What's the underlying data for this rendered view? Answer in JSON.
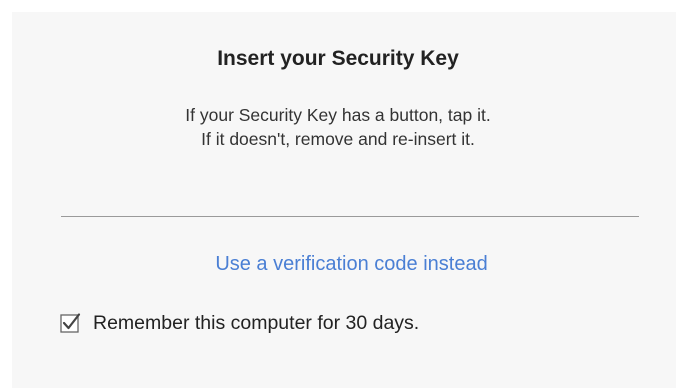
{
  "dialog": {
    "title": "Insert your Security Key",
    "description": [
      "If your Security Key has a button, tap it.",
      "If it doesn't, remove and re-insert it."
    ],
    "alt_method_link": "Use a verification code instead",
    "remember": {
      "label": "Remember this computer for 30 days.",
      "checked": true,
      "icon": "checkmark-icon"
    }
  },
  "colors": {
    "panel_bg": "#f7f7f7",
    "link": "#4a7fd4",
    "divider": "#9a9a9a",
    "text": "#222222"
  }
}
